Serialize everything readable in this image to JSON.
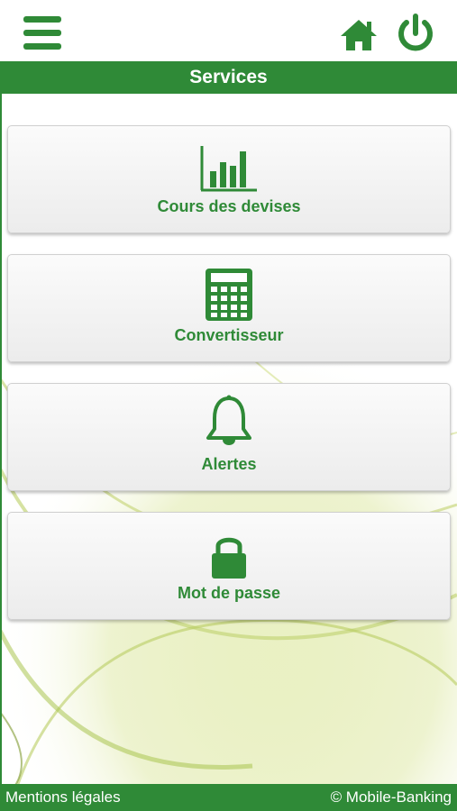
{
  "colors": {
    "brand_green": "#2f8a37",
    "footer_green": "#2f8a37",
    "tile_bg": "#f2f2f2"
  },
  "header": {
    "menu_icon": "hamburger-menu-icon",
    "home_icon": "home-icon",
    "power_icon": "power-icon",
    "title": "Services"
  },
  "services": [
    {
      "label": "Cours des devises",
      "icon": "bar-chart-icon"
    },
    {
      "label": "Convertisseur",
      "icon": "calculator-icon"
    },
    {
      "label": "Alertes",
      "icon": "bell-icon"
    },
    {
      "label": "Mot de passe",
      "icon": "padlock-icon"
    }
  ],
  "footer": {
    "legal_link": "Mentions légales",
    "copyright": "© Mobile-Banking"
  }
}
